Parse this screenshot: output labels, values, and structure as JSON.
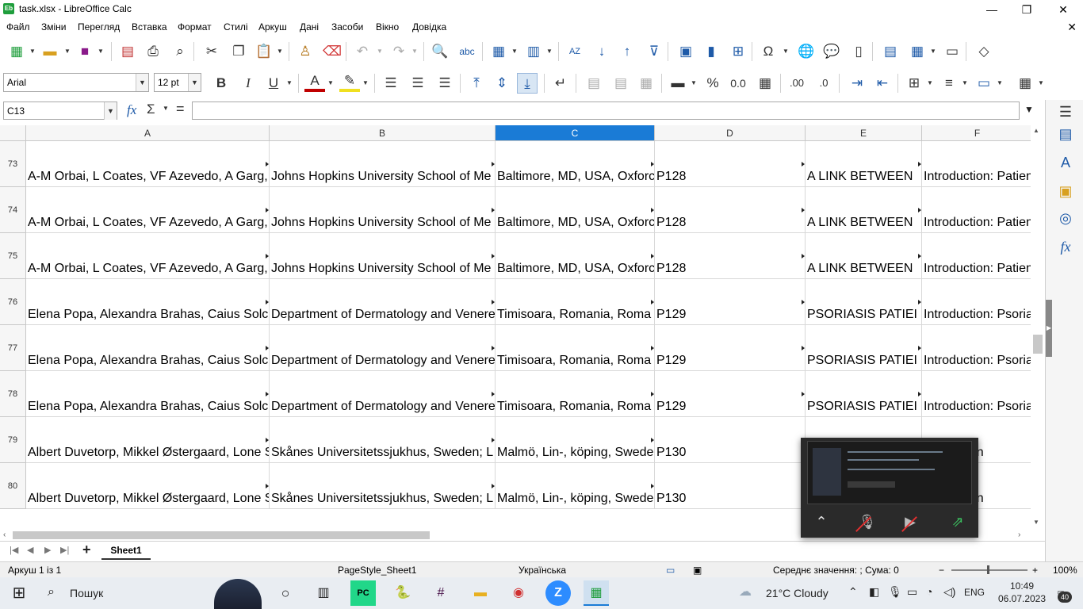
{
  "window": {
    "title": "task.xlsx - LibreOffice Calc",
    "app_icon_text": "Eb",
    "minimize": "—",
    "restore": "❐",
    "close": "✕"
  },
  "menu": {
    "items": [
      "Файл",
      "Зміни",
      "Перегляд",
      "Вставка",
      "Формат",
      "Стилі",
      "Аркуш",
      "Дані",
      "Засоби",
      "Вікно",
      "Довідка"
    ],
    "close_doc": "✕"
  },
  "format_toolbar": {
    "font_name": "Arial",
    "font_size": "12 pt",
    "bold": "B",
    "italic": "I",
    "underline": "U",
    "font_color_label": "A",
    "percent": "%",
    "decimal": "0.0",
    "add_decimal": ".00",
    "del_decimal": ".0"
  },
  "formula_bar": {
    "name_box": "C13",
    "fx": "fx",
    "sum": "Σ",
    "equals": "=",
    "content": ""
  },
  "columns": [
    {
      "label": "A",
      "selected": false
    },
    {
      "label": "B",
      "selected": false
    },
    {
      "label": "C",
      "selected": true
    },
    {
      "label": "D",
      "selected": false
    },
    {
      "label": "E",
      "selected": false
    },
    {
      "label": "F",
      "selected": false
    }
  ],
  "rows": [
    {
      "num": "73",
      "cells": [
        "A-M Orbai, L Coates, VF Azevedo, A Garg,",
        "Johns Hopkins University School of Me",
        "Baltimore, MD, USA, Oxforc",
        "P128",
        "A LINK BETWEEN",
        "Introduction: Patien"
      ]
    },
    {
      "num": "74",
      "cells": [
        "A-M Orbai, L Coates, VF Azevedo, A Garg,",
        "Johns Hopkins University School of Me",
        "Baltimore, MD, USA, Oxforc",
        "P128",
        "A LINK BETWEEN",
        "Introduction: Patien"
      ]
    },
    {
      "num": "75",
      "cells": [
        "A-M Orbai, L Coates, VF Azevedo, A Garg,",
        "Johns Hopkins University School of Me",
        "Baltimore, MD, USA, Oxforc",
        "P128",
        "A LINK BETWEEN",
        "Introduction: Patien"
      ]
    },
    {
      "num": "76",
      "cells": [
        "Elena Popa, Alexandra Brahas, Caius Solc",
        "Department of Dermatology and Venere",
        "Timisoara, Romania, Roma",
        "P129",
        "PSORIASIS PATIEI",
        "Introduction: Psoria"
      ]
    },
    {
      "num": "77",
      "cells": [
        "Elena Popa, Alexandra Brahas, Caius Solc",
        "Department of Dermatology and Venere",
        "Timisoara, Romania, Roma",
        "P129",
        "PSORIASIS PATIEI",
        "Introduction: Psoria"
      ]
    },
    {
      "num": "78",
      "cells": [
        "Elena Popa, Alexandra Brahas, Caius Solc",
        "Department of Dermatology and Venere",
        "Timisoara, Romania, Roma",
        "P129",
        "PSORIASIS PATIEI",
        "Introduction: Psoria"
      ]
    },
    {
      "num": "79",
      "cells": [
        "Albert Duvetorp, Mikkel Østergaard, Lone S",
        "Skånes Universitetssjukhus, Sweden; L",
        "Malmö, Lin-, köping, Swede",
        "P130",
        "",
        "ion: Patien"
      ]
    },
    {
      "num": "80",
      "cells": [
        "Albert Duvetorp, Mikkel Østergaard, Lone S",
        "Skånes Universitetssjukhus, Sweden; L",
        "Malmö, Lin-, köping, Swede",
        "P130",
        "",
        "ion: Patien"
      ]
    }
  ],
  "sheet_tabs": {
    "add": "+",
    "active": "Sheet1"
  },
  "status_bar": {
    "sheet_info": "Аркуш 1 із 1",
    "page_style": "PageStyle_Sheet1",
    "language": "Українська",
    "summary": "Середнє значення: ; Сума: 0",
    "zoom": "100%",
    "zoom_minus": "−",
    "zoom_plus": "+"
  },
  "taskbar": {
    "search_label": "Пошук",
    "weather": "21°C  Cloudy",
    "lang": "ENG",
    "time": "10:49",
    "date": "06.07.2023",
    "notifications": "40"
  }
}
